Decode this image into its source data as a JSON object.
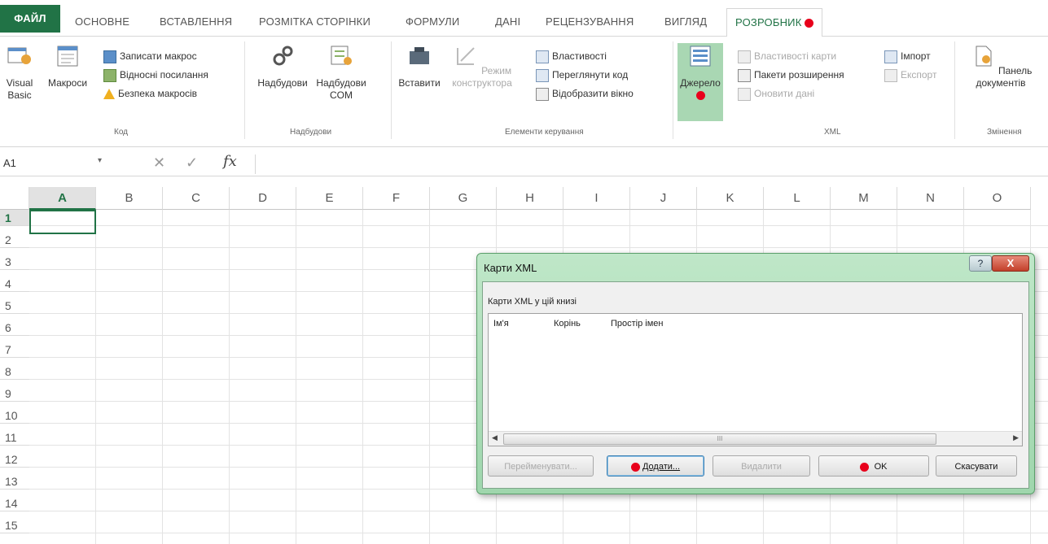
{
  "tabs": [
    "ФАЙЛ",
    "ОСНОВНЕ",
    "ВСТАВЛЕННЯ",
    "РОЗМІТКА СТОРІНКИ",
    "ФОРМУЛИ",
    "ДАНІ",
    "РЕЦЕНЗУВАННЯ",
    "ВИГЛЯД",
    "РОЗРОБНИК"
  ],
  "ribbon": {
    "code": {
      "label": "Код",
      "visual_basic": "Visual Basic",
      "macros": "Макроси",
      "record": "Записати макрос",
      "relative": "Відносні посилання",
      "security": "Безпека макросів"
    },
    "addins": {
      "label": "Надбудови",
      "addins": "Надбудови",
      "com": "Надбудови COM"
    },
    "controls": {
      "label": "Елементи керування",
      "insert": "Вставити",
      "design": "Режим конструктора",
      "properties": "Властивості",
      "view_code": "Переглянути код",
      "show_window": "Відобразити вікно"
    },
    "xml": {
      "label": "XML",
      "source": "Джерело",
      "map_props": "Властивості карти",
      "packs": "Пакети розширення",
      "refresh": "Оновити дані",
      "import": "Імпорт",
      "export": "Експорт"
    },
    "modify": {
      "label": "Змінення",
      "doc_panel": "Панель документів"
    }
  },
  "formula": {
    "name_box": "A1",
    "fx": "fx",
    "cancel": "✕",
    "enter": "✓"
  },
  "grid": {
    "columns": [
      "A",
      "B",
      "C",
      "D",
      "E",
      "F",
      "G",
      "H",
      "I",
      "J",
      "K",
      "L",
      "M",
      "N",
      "O"
    ],
    "rows": [
      "1",
      "2",
      "3",
      "4",
      "5",
      "6",
      "7",
      "8",
      "9",
      "10",
      "11",
      "12",
      "13",
      "14",
      "15"
    ]
  },
  "dialog": {
    "title": "Карти XML",
    "help": "?",
    "close": "X",
    "subtitle": "Карти XML у цій книзі",
    "headers": [
      "Ім'я",
      "Корінь",
      "Простір імен"
    ],
    "scroll_mark": "III",
    "buttons": {
      "rename": "Перейменувати...",
      "add": "Додати...",
      "delete": "Видалити",
      "ok": "OK",
      "cancel": "Скасувати"
    }
  },
  "colors": {
    "accent": "#217346",
    "marker": "#e8001b"
  }
}
